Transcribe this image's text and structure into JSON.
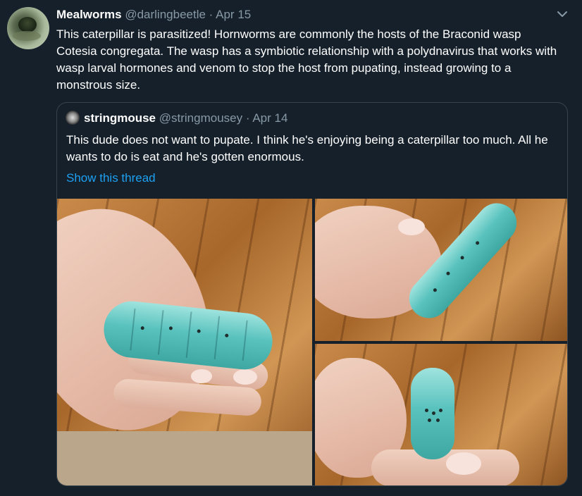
{
  "tweet": {
    "author_name": "Mealworms",
    "author_handle": "@darlingbeetle",
    "separator": "·",
    "date": "Apr 15",
    "text": "This caterpillar is parasitized! Hornworms are commonly the hosts of the Braconid wasp Cotesia congregata. The wasp has a symbiotic relationship with a polydnavirus that works with wasp larval hormones and venom to stop the host from pupating, instead growing to a monstrous size."
  },
  "quoted": {
    "author_name": "stringmouse",
    "author_handle": "@stringmousey",
    "separator": "·",
    "date": "Apr 14",
    "text": "This dude does not want to pupate. I think he's enjoying being a caterpillar too much. All he wants to do is eat and he's gotten enormous.",
    "show_thread": "Show this thread"
  },
  "icons": {
    "more": "chevron-down-icon"
  },
  "colors": {
    "background": "#15202b",
    "secondary_text": "#8899a6",
    "link": "#1da1f2",
    "border": "#38444d"
  }
}
